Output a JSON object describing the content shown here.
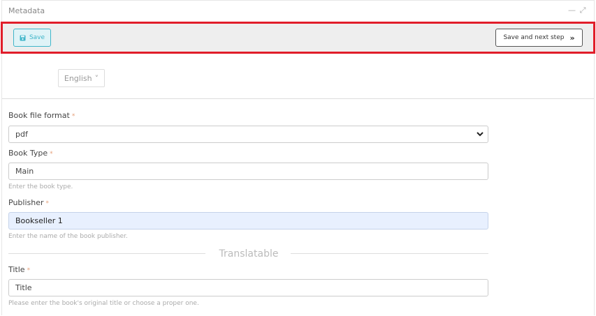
{
  "window": {
    "title": "Metadata",
    "minimize_glyph": "—",
    "expand_glyph": "⤢"
  },
  "toolbar": {
    "save_label": "Save",
    "save_next_label": "Save and next step",
    "save_next_glyph": "»",
    "highlight_color": "#e11d2a"
  },
  "language": {
    "selected": "English",
    "chevron_glyph": "˅"
  },
  "form": {
    "book_file_format": {
      "label": "Book file format",
      "required_mark": "*",
      "value": "pdf"
    },
    "book_type": {
      "label": "Book Type",
      "required_mark": "*",
      "value": "Main",
      "help": "Enter the book type."
    },
    "publisher": {
      "label": "Publisher",
      "required_mark": "*",
      "value": "Bookseller 1",
      "help": "Enter the name of the book publisher."
    },
    "section_heading": "Translatable",
    "title": {
      "label": "Title",
      "required_mark": "*",
      "value": "Title",
      "help": "Please enter the book's original title or choose a proper one."
    }
  },
  "colors": {
    "save_accent": "#3fb5c9",
    "required_mark": "#e6a07a",
    "autofill_bg": "#e8f0fe"
  }
}
